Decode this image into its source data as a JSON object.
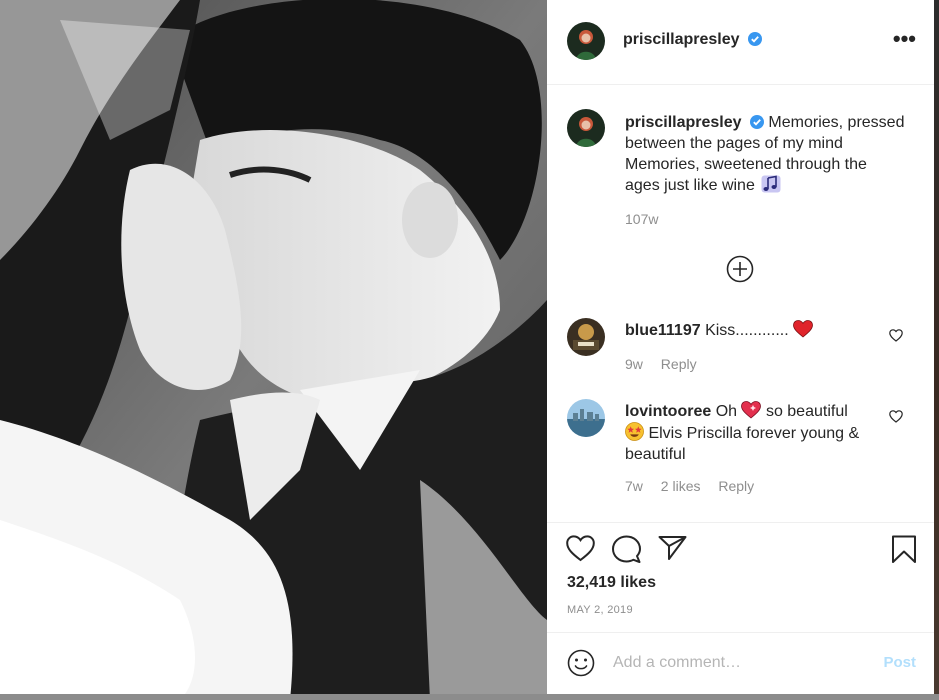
{
  "post": {
    "author": "priscillapresley",
    "caption_text": "Memories, pressed between the pages of my mind Memories, sweetened through the ages just like wine",
    "caption_emoji": "music-notes-emoji",
    "caption_age": "107w",
    "likes": "32,419 likes",
    "date": "MAY 2, 2019"
  },
  "comments": [
    {
      "username": "blue11197",
      "text": "Kiss............",
      "emoji": "red-heart-emoji",
      "age": "9w",
      "reply_label": "Reply"
    },
    {
      "username": "lovintooree",
      "text_before": "Oh",
      "text_after": "so beautiful",
      "text_line2": "Elvis Priscilla forever young & beautiful",
      "age": "7w",
      "likes_label": "2 likes",
      "reply_label": "Reply"
    }
  ],
  "composer": {
    "placeholder": "Add a comment…",
    "post_label": "Post"
  },
  "colors": {
    "verified": "#3897f0",
    "post_button": "#b2dffc",
    "muted_text": "#8e8e8e"
  }
}
